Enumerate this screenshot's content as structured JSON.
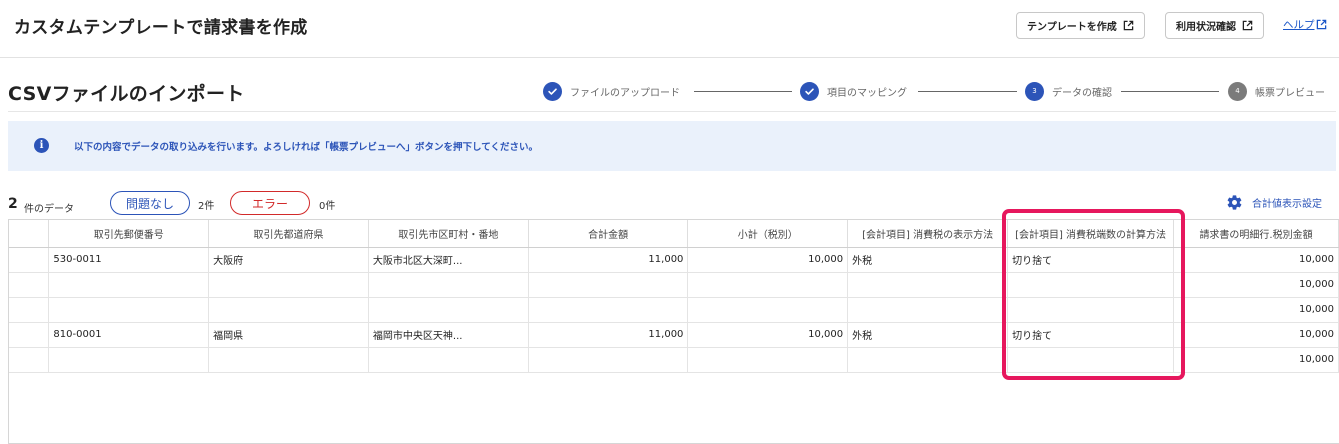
{
  "header": {
    "title": "カスタムテンプレートで請求書を作成",
    "create_template_label": "テンプレートを作成",
    "usage_status_label": "利用状況確認",
    "help_label": "ヘルプ"
  },
  "page": {
    "title": "CSVファイルのインポート"
  },
  "steps": [
    {
      "label": "ファイルのアップロード",
      "state": "done"
    },
    {
      "label": "項目のマッピング",
      "state": "done"
    },
    {
      "label": "データの確認",
      "state": "current",
      "number": "3"
    },
    {
      "label": "帳票プレビュー",
      "state": "todo",
      "number": "4"
    }
  ],
  "info": {
    "icon": "info-icon",
    "message": "以下の内容でデータの取り込みを行います。よろしければ「帳票プレビューへ」ボタンを押下してください。"
  },
  "summary": {
    "count": "2",
    "count_label": "件のデータ",
    "ok_label": "問題なし",
    "ok_count": "2件",
    "error_label": "エラー",
    "error_count": "0件",
    "settings_label": "合計値表示設定"
  },
  "table": {
    "columns": [
      "",
      "取引先郵便番号",
      "取引先都道府県",
      "取引先市区町村・番地",
      "合計金額",
      "小計（税別）",
      "[会計項目] 消費税の表示方法",
      "[会計項目] 消費税端数の計算方法",
      "請求書の明細行.税別金額"
    ],
    "rows": [
      [
        "",
        "530-0011",
        "大阪府",
        "大阪市北区大深町...",
        "11,000",
        "10,000",
        "外税",
        "切り捨て",
        "10,000"
      ],
      [
        "",
        "",
        "",
        "",
        "",
        "",
        "",
        "",
        "10,000"
      ],
      [
        "",
        "",
        "",
        "",
        "",
        "",
        "",
        "",
        "10,000"
      ],
      [
        "",
        "810-0001",
        "福岡県",
        "福岡市中央区天神...",
        "11,000",
        "10,000",
        "外税",
        "切り捨て",
        "10,000"
      ],
      [
        "",
        "",
        "",
        "",
        "",
        "",
        "",
        "",
        "10,000"
      ]
    ]
  },
  "colors": {
    "accent": "#2c54b8",
    "error": "#d22a2a",
    "highlight": "#e6175d",
    "info_bg": "#eaf1fb"
  }
}
